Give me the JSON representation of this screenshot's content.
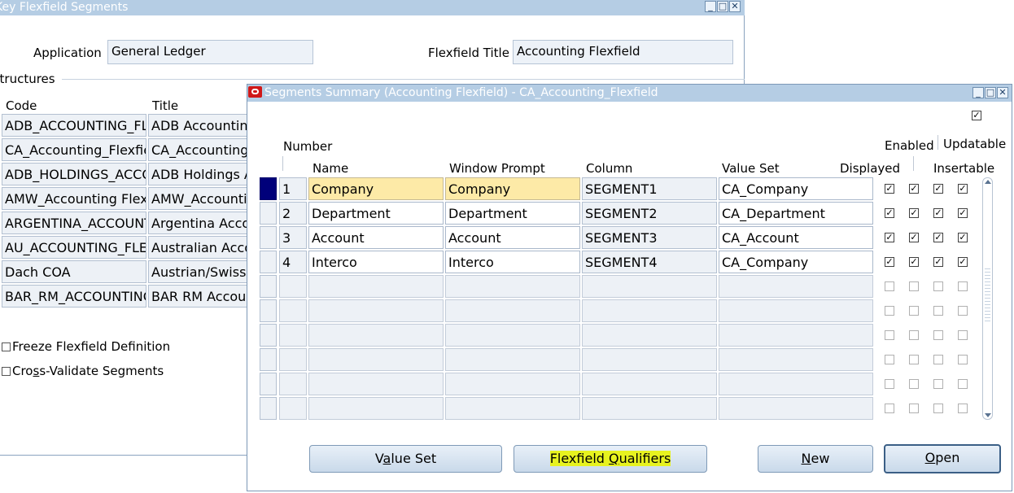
{
  "back_window": {
    "title": "Key Flexfield Segments",
    "application_label": "Application",
    "application_value": "General Ledger",
    "flexfield_title_label": "Flexfield Title",
    "flexfield_title_value": "Accounting Flexfield",
    "structures_label": "Structures",
    "code_header": "Code",
    "title_header": "Title",
    "rows": [
      {
        "code": "ADB_ACCOUNTING_FL",
        "title": "ADB Accounting"
      },
      {
        "code": "CA_Accounting_Flexfiel",
        "title": "CA_Accounting_"
      },
      {
        "code": "ADB_HOLDINGS_ACCO",
        "title": "ADB Holdings A"
      },
      {
        "code": "AMW_Accounting Flexfi",
        "title": "AMW_Accountin"
      },
      {
        "code": "ARGENTINA_ACCOUNT",
        "title": "Argentina Accou"
      },
      {
        "code": "AU_ACCOUNTING_FLE",
        "title": "Australian Accou"
      },
      {
        "code": "Dach COA",
        "title": "Austrian/Swiss C"
      },
      {
        "code": "BAR_RM_ACCOUNTING",
        "title": "BAR RM Accoun"
      }
    ],
    "freeze_label": "Freeze Flexfield Definition",
    "crossval_label_pre": "Cro",
    "crossval_label_u": "s",
    "crossval_label_post": "s-Validate Segments"
  },
  "front_window": {
    "title": "Segments Summary (Accounting Flexfield) - CA_Accounting_Flexfield",
    "headers": {
      "number": "Number",
      "name": "Name",
      "window_prompt": "Window Prompt",
      "column": "Column",
      "value_set": "Value Set",
      "displayed": "Displayed",
      "enabled": "Enabled",
      "updatable": "Updatable",
      "insertable": "Insertable"
    },
    "rows": [
      {
        "number": "1",
        "name": "Company",
        "prompt": "Company",
        "column": "SEGMENT1",
        "value_set": "CA_Company"
      },
      {
        "number": "2",
        "name": "Department",
        "prompt": "Department",
        "column": "SEGMENT2",
        "value_set": "CA_Department"
      },
      {
        "number": "3",
        "name": "Account",
        "prompt": "Account",
        "column": "SEGMENT3",
        "value_set": "CA_Account"
      },
      {
        "number": "4",
        "name": "Interco",
        "prompt": "Interco",
        "column": "SEGMENT4",
        "value_set": "CA_Company"
      }
    ],
    "buttons": {
      "value_set_pre": "V",
      "value_set_u": "a",
      "value_set_post": "lue Set",
      "qualifiers_pre": "Flexfield ",
      "qualifiers_u": "Q",
      "qualifiers_post": "ualifiers",
      "new_u": "N",
      "new_post": "ew",
      "open_u": "O",
      "open_post": "pen"
    }
  },
  "icons": {
    "minimize": "minimize-icon",
    "maximize": "maximize-icon",
    "close": "close-icon",
    "oracle": "oracle-logo-icon"
  },
  "colors": {
    "titlebar": "#b5cde4",
    "current_row_indicator": "#00007a",
    "highlight_yellow": "#fdeaa7",
    "marker_highlight": "#e7f21f"
  }
}
